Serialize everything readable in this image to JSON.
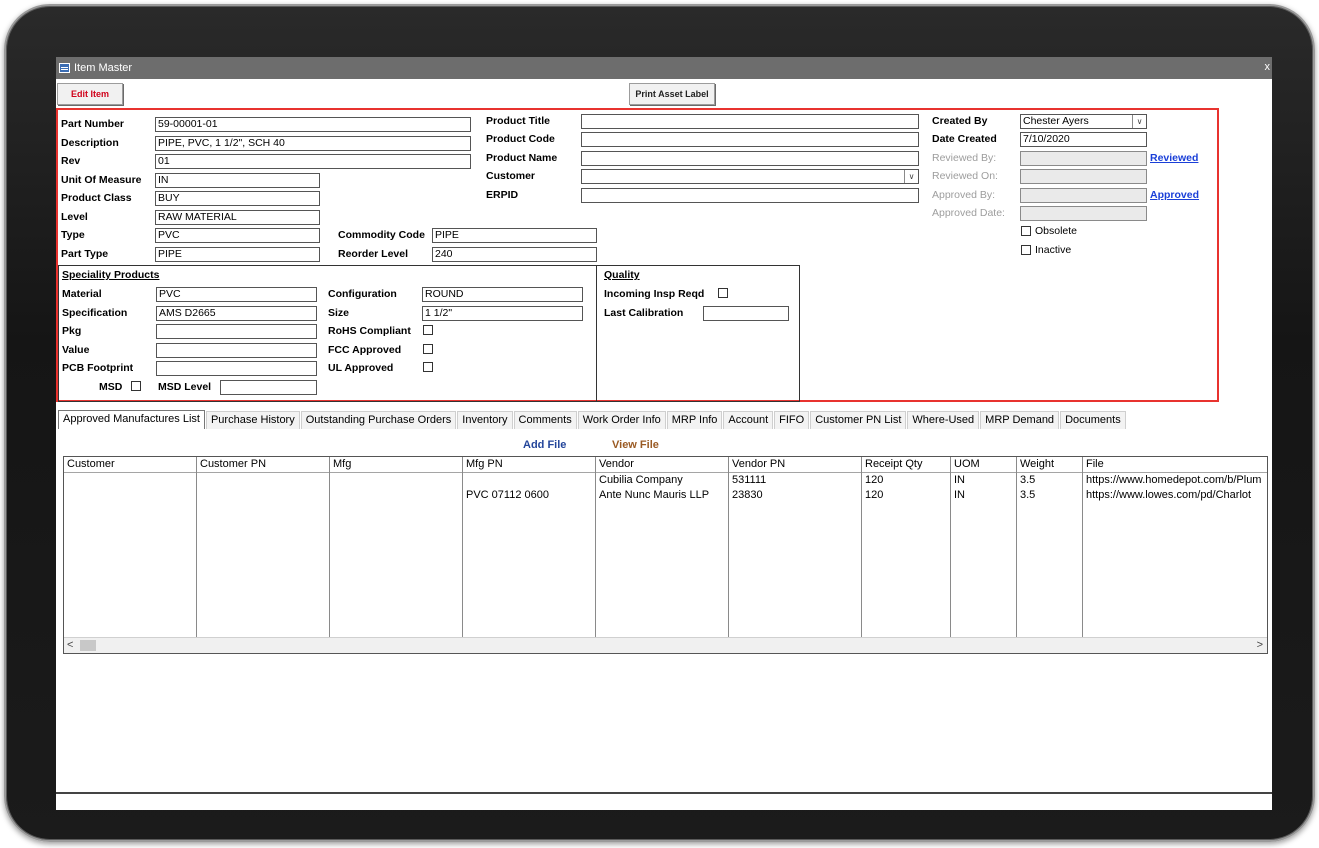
{
  "window": {
    "title": "Item Master",
    "close_glyph": "x"
  },
  "toolbar": {
    "edit_label": "Edit Item",
    "print_label": "Print Asset Label"
  },
  "fields": {
    "part_number": {
      "label": "Part Number",
      "value": "59-00001-01"
    },
    "description": {
      "label": "Description",
      "value": "PIPE, PVC, 1 1/2\", SCH 40"
    },
    "rev": {
      "label": "Rev",
      "value": "01"
    },
    "uom": {
      "label": "Unit Of Measure",
      "value": "IN"
    },
    "product_class": {
      "label": "Product Class",
      "value": "BUY"
    },
    "level": {
      "label": "Level",
      "value": "RAW MATERIAL"
    },
    "type": {
      "label": "Type",
      "value": "PVC"
    },
    "part_type": {
      "label": "Part Type",
      "value": "PIPE"
    },
    "commodity_code": {
      "label": "Commodity Code",
      "value": "PIPE"
    },
    "reorder_level": {
      "label": "Reorder Level",
      "value": "240"
    },
    "product_title": {
      "label": "Product Title",
      "value": ""
    },
    "product_code": {
      "label": "Product Code",
      "value": ""
    },
    "product_name": {
      "label": "Product Name",
      "value": ""
    },
    "customer": {
      "label": "Customer",
      "value": ""
    },
    "erpid": {
      "label": "ERPID",
      "value": ""
    },
    "created_by": {
      "label": "Created By",
      "value": "Chester Ayers"
    },
    "date_created": {
      "label": "Date Created",
      "value": "7/10/2020"
    },
    "reviewed_by": {
      "label": "Reviewed By:",
      "value": ""
    },
    "reviewed_on": {
      "label": "Reviewed On:",
      "value": ""
    },
    "approved_by": {
      "label": "Approved By:",
      "value": ""
    },
    "approved_date": {
      "label": "Approved Date:",
      "value": ""
    },
    "reviewed_link": "Reviewed",
    "approved_link": "Approved",
    "obsolete": {
      "label": "Obsolete",
      "checked": false
    },
    "inactive": {
      "label": "Inactive",
      "checked": false
    }
  },
  "speciality": {
    "title": "Speciality Products",
    "material": {
      "label": "Material",
      "value": "PVC"
    },
    "specification": {
      "label": "Specification",
      "value": "AMS D2665"
    },
    "pkg": {
      "label": "Pkg",
      "value": ""
    },
    "value": {
      "label": "Value",
      "value": ""
    },
    "pcb_footprint": {
      "label": "PCB Footprint",
      "value": ""
    },
    "msd": {
      "label": "MSD",
      "checked": false
    },
    "msd_level": {
      "label": "MSD Level",
      "value": ""
    },
    "configuration": {
      "label": "Configuration",
      "value": "ROUND"
    },
    "size": {
      "label": "Size",
      "value": "1 1/2\""
    },
    "rohs": {
      "label": "RoHS Compliant",
      "checked": false
    },
    "fcc": {
      "label": "FCC Approved",
      "checked": false
    },
    "ul": {
      "label": "UL Approved",
      "checked": false
    }
  },
  "quality": {
    "title": "Quality",
    "incoming": {
      "label": "Incoming Insp Reqd",
      "checked": false
    },
    "last_calibration": {
      "label": "Last Calibration",
      "value": ""
    }
  },
  "tabs": [
    "Approved Manufactures List",
    "Purchase History",
    "Outstanding Purchase Orders",
    "Inventory",
    "Comments",
    "Work Order Info",
    "MRP Info",
    "Account",
    "FIFO",
    "Customer PN List",
    "Where-Used",
    "MRP Demand",
    "Documents"
  ],
  "file_actions": {
    "add": "Add File",
    "view": "View File"
  },
  "grid": {
    "columns": [
      "Customer",
      "Customer PN",
      "Mfg",
      "Mfg PN",
      "Vendor",
      "Vendor PN",
      "Receipt Qty",
      "UOM",
      "Weight",
      "File"
    ],
    "rows": [
      [
        "",
        "",
        "",
        "",
        "Cubilia Company",
        "531111",
        "120",
        "IN",
        "3.5",
        "https://www.homedepot.com/b/Plum"
      ],
      [
        "",
        "",
        "",
        "PVC 07112 0600",
        "Ante Nunc Mauris LLP",
        "23830",
        "120",
        "IN",
        "3.5",
        "https://www.lowes.com/pd/Charlot"
      ]
    ],
    "scroll_left": "<",
    "scroll_right": ">"
  }
}
